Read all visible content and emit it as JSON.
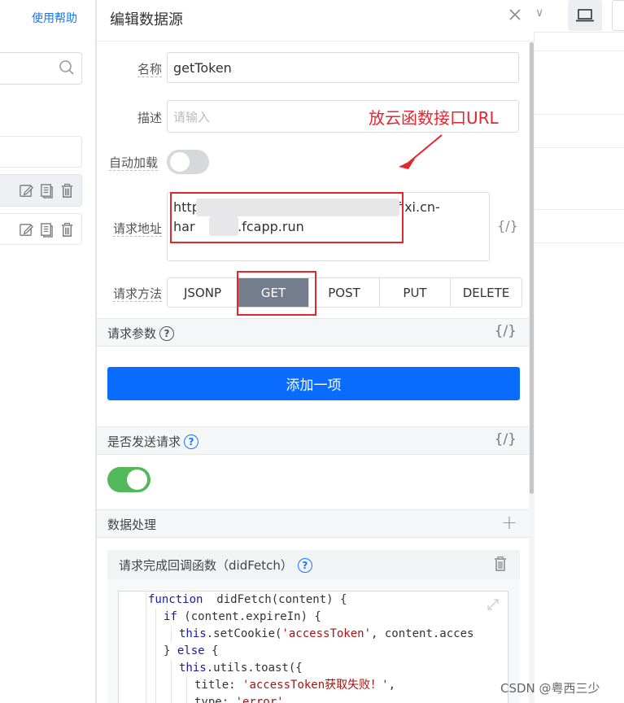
{
  "left_panel": {
    "help_link": "使用帮助"
  },
  "drawer": {
    "title": "编辑数据源",
    "fields": {
      "name_label": "名称",
      "name_value": "getToken",
      "desc_label": "描述",
      "desc_placeholder": "请输入",
      "autoload_label": "自动加载",
      "url_label": "请求地址",
      "url_line1_start": "http",
      "url_line1_end": "fixi.cn-",
      "url_line2_start": "har",
      "url_line2_end": "u.fcapp.run",
      "url_var_button": "{/}",
      "method_label": "请求方法"
    },
    "methods": [
      {
        "label": "JSONP",
        "active": false
      },
      {
        "label": "GET",
        "active": true
      },
      {
        "label": "POST",
        "active": false
      },
      {
        "label": "PUT",
        "active": false
      },
      {
        "label": "DELETE",
        "active": false
      }
    ],
    "params_section": {
      "title": "请求参数",
      "var_button": "{/}"
    },
    "add_item_button": "添加一项",
    "send_section": {
      "title": "是否发送请求",
      "var_button": "{/}",
      "enabled": true
    },
    "process_section": {
      "title": "数据处理",
      "plus": "+"
    },
    "callback": {
      "title": "请求完成回调函数（didFetch）",
      "code_lines": [
        {
          "indent": 0,
          "parts": [
            [
              "kw",
              "function"
            ],
            [
              "",
              "  didFetch(content) {"
            ]
          ]
        },
        {
          "indent": 1,
          "parts": [
            [
              "kw",
              "if"
            ],
            [
              "",
              " (content.expireIn) {"
            ]
          ]
        },
        {
          "indent": 2,
          "parts": [
            [
              "kw",
              "this"
            ],
            [
              "",
              ".setCookie("
            ],
            [
              "str",
              "'accessToken'"
            ],
            [
              "",
              ", content.acces"
            ]
          ]
        },
        {
          "indent": 1,
          "parts": [
            [
              "",
              "} "
            ],
            [
              "kw",
              "else"
            ],
            [
              "",
              " {"
            ]
          ]
        },
        {
          "indent": 2,
          "parts": [
            [
              "kw",
              "this"
            ],
            [
              "",
              ".utils.toast({"
            ]
          ]
        },
        {
          "indent": 3,
          "parts": [
            [
              "",
              "title: "
            ],
            [
              "str",
              "'accessToken获取失败！'"
            ],
            [
              "",
              ","
            ]
          ]
        },
        {
          "indent": 3,
          "parts": [
            [
              "",
              "type: "
            ],
            [
              "str",
              "'error'"
            ]
          ]
        }
      ]
    }
  },
  "annotation": {
    "note": "放云函数接口URL",
    "color": "#e3262f"
  },
  "watermark": "CSDN @粤西三少",
  "colors": {
    "primary": "#0a6cff",
    "active_method": "#747d8c",
    "toggle_on": "#52b95a",
    "toggle_off": "#d6d8dc"
  }
}
